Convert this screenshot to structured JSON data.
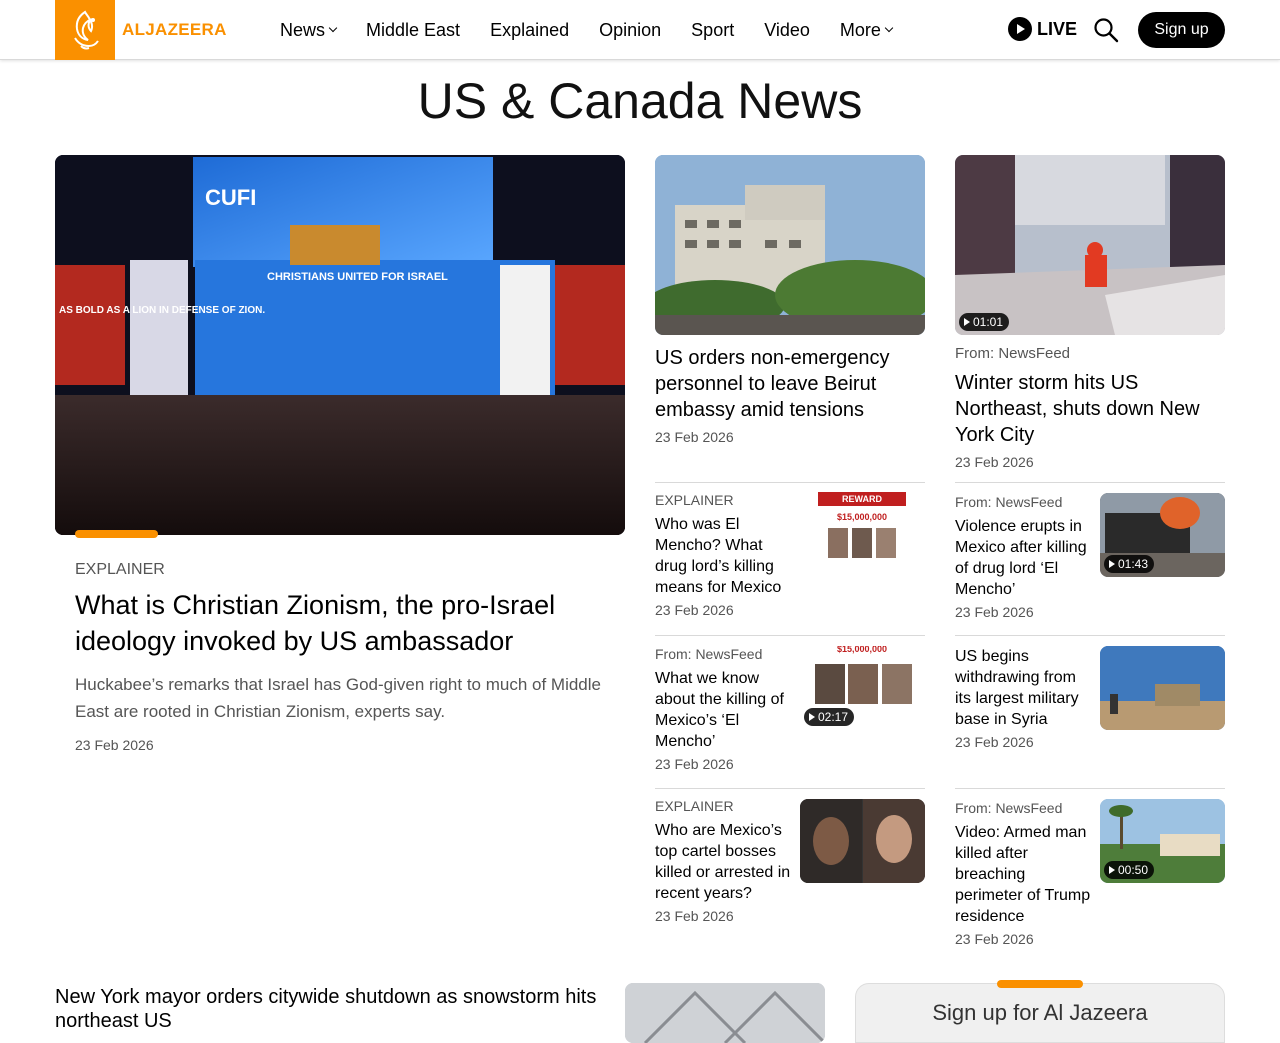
{
  "header": {
    "logo_text": "ALJAZEERA",
    "nav": [
      "News",
      "Middle East",
      "Explained",
      "Opinion",
      "Sport",
      "Video",
      "More"
    ],
    "live_label": "LIVE",
    "signup_label": "Sign up"
  },
  "page_title": "US & Canada News",
  "featured": {
    "kicker": "EXPLAINER",
    "headline": "What is Christian Zionism, the pro-Israel ideology invoked by US ambassador",
    "summary": "Huckabee’s remarks that Israel has God-given right to much of Middle East are rooted in Christian Zionism, experts say.",
    "date": "23 Feb 2026"
  },
  "top_cards": [
    {
      "headline": "US orders non-emergency personnel to leave Beirut embassy amid tensions",
      "date": "23 Feb 2026"
    },
    {
      "kicker": "From: NewsFeed",
      "headline": "Winter storm hits US Northeast, shuts down New York City",
      "date": "23 Feb 2026",
      "video": "01:01"
    }
  ],
  "list_left": [
    {
      "kicker": "EXPLAINER",
      "headline": "Who was El Mencho? What drug lord’s killing means for Mexico",
      "date": "23 Feb 2026",
      "poster_title": "REWARD",
      "poster_amount": "$15,000,000"
    },
    {
      "kicker": "From: NewsFeed",
      "headline": "What we know about the killing of Mexico’s ‘El Mencho’",
      "date": "23 Feb 2026",
      "video": "02:17",
      "poster_amount": "$15,000,000"
    },
    {
      "kicker": "EXPLAINER",
      "headline": "Who are Mexico’s top cartel bosses killed or arrested in recent years?",
      "date": "23 Feb 2026"
    }
  ],
  "list_right": [
    {
      "kicker": "From: NewsFeed",
      "headline": "Violence erupts in Mexico after killing of drug lord ‘El Mencho’",
      "date": "23 Feb 2026",
      "video": "01:43"
    },
    {
      "headline": "US begins withdrawing from its largest military base in Syria",
      "date": "23 Feb 2026"
    },
    {
      "kicker": "From: NewsFeed",
      "headline": "Video: Armed man killed after breaching perimeter of Trump residence",
      "date": "23 Feb 2026",
      "video": "00:50"
    }
  ],
  "bottom": {
    "headline": "New York mayor orders citywide shutdown as snowstorm hits northeast US",
    "signup_box_title": "Sign up for Al Jazeera"
  },
  "hero_banner": {
    "backdrop_text": "CUFI",
    "banner_text": "CHRISTIANS UNITED FOR ISRAEL",
    "side_text": "AS BOLD AS A LION IN DEFENSE OF ZION."
  },
  "colors": {
    "brand": "#fa9000",
    "text": "#000000",
    "muted": "#555555"
  }
}
